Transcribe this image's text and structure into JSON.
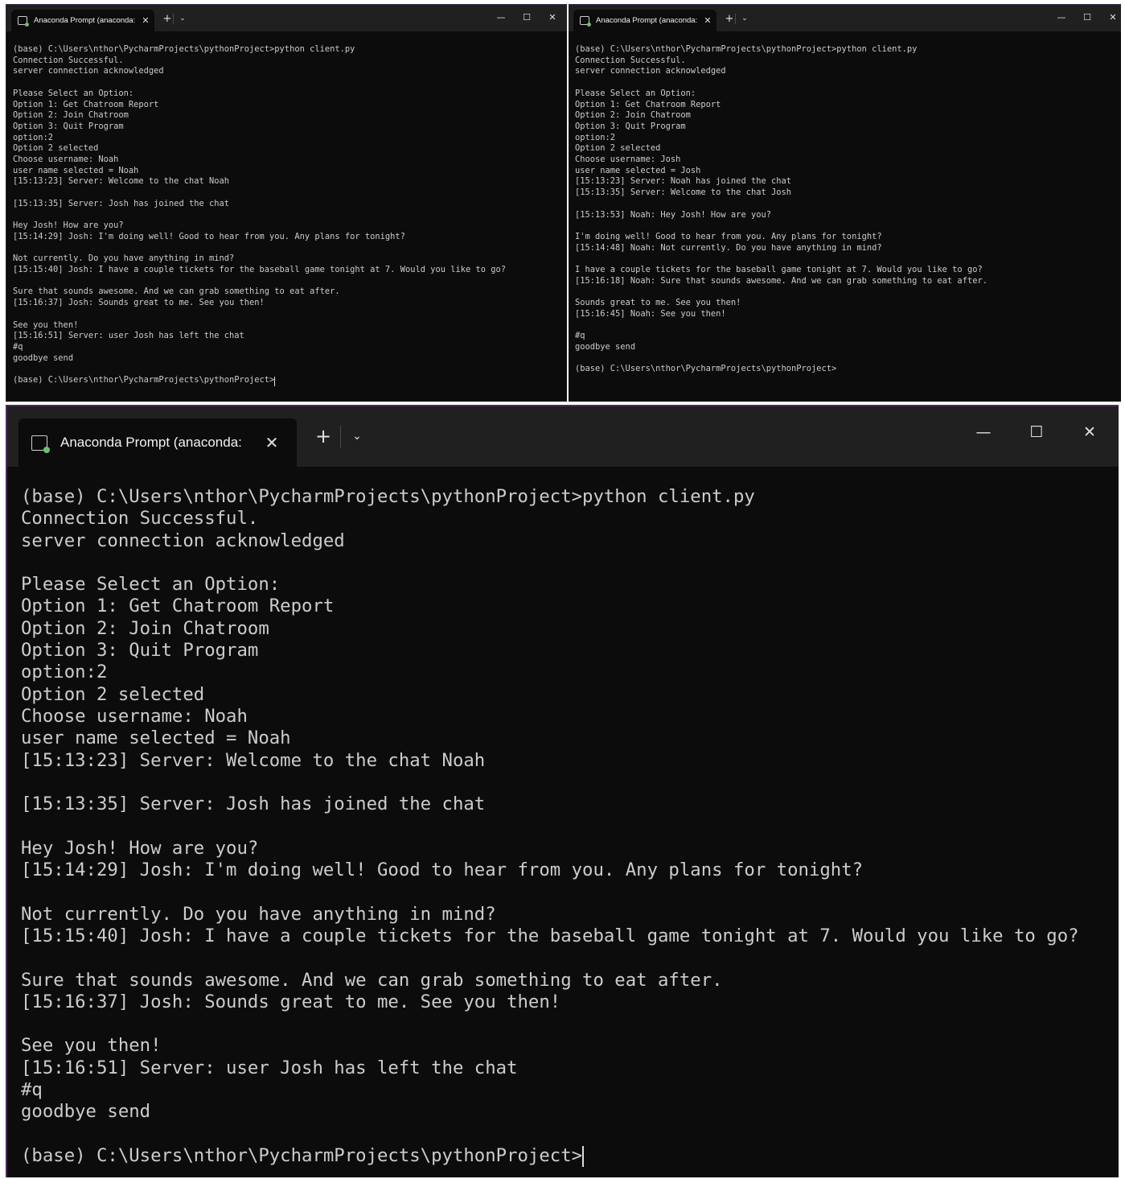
{
  "colors": {
    "terminal_bg": "#0c0c0c",
    "titlebar_bg": "#202020",
    "text": "#cccccc",
    "icon_accent": "#6cc06c"
  },
  "icons": {
    "tab_icon": "anaconda-prompt-icon",
    "tab_close": "close-icon",
    "new_tab": "plus-icon",
    "tab_menu": "chevron-down-icon",
    "minimize": "minimize-icon",
    "maximize": "maximize-icon",
    "close": "close-icon"
  },
  "controls": {
    "close_tab": "✕",
    "new_tab": "+",
    "dropdown": "⌄",
    "minimize": "—",
    "maximize": "☐",
    "close_window": "✕"
  },
  "windows": [
    {
      "id": "noah-small",
      "tab_title": "Anaconda Prompt (anaconda:",
      "lines": [
        "(base) C:\\Users\\nthor\\PycharmProjects\\pythonProject>python client.py",
        "Connection Successful.",
        "server connection acknowledged",
        "",
        "Please Select an Option:",
        "Option 1: Get Chatroom Report",
        "Option 2: Join Chatroom",
        "Option 3: Quit Program",
        "option:2",
        "Option 2 selected",
        "Choose username: Noah",
        "user name selected = Noah",
        "[15:13:23] Server: Welcome to the chat Noah",
        "",
        "[15:13:35] Server: Josh has joined the chat",
        "",
        "Hey Josh! How are you?",
        "[15:14:29] Josh: I'm doing well! Good to hear from you. Any plans for tonight?",
        "",
        "Not currently. Do you have anything in mind?",
        "[15:15:40] Josh: I have a couple tickets for the baseball game tonight at 7. Would you like to go?",
        "",
        "Sure that sounds awesome. And we can grab something to eat after.",
        "[15:16:37] Josh: Sounds great to me. See you then!",
        "",
        "See you then!",
        "[15:16:51] Server: user Josh has left the chat",
        "#q",
        "goodbye send",
        "",
        "(base) C:\\Users\\nthor\\PycharmProjects\\pythonProject>"
      ]
    },
    {
      "id": "josh-small",
      "tab_title": "Anaconda Prompt (anaconda:",
      "lines": [
        "(base) C:\\Users\\nthor\\PycharmProjects\\pythonProject>python client.py",
        "Connection Successful.",
        "server connection acknowledged",
        "",
        "Please Select an Option:",
        "Option 1: Get Chatroom Report",
        "Option 2: Join Chatroom",
        "Option 3: Quit Program",
        "option:2",
        "Option 2 selected",
        "Choose username: Josh",
        "user name selected = Josh",
        "[15:13:23] Server: Noah has joined the chat",
        "[15:13:35] Server: Welcome to the chat Josh",
        "",
        "[15:13:53] Noah: Hey Josh! How are you?",
        "",
        "I'm doing well! Good to hear from you. Any plans for tonight?",
        "[15:14:48] Noah: Not currently. Do you have anything in mind?",
        "",
        "I have a couple tickets for the baseball game tonight at 7. Would you like to go?",
        "[15:16:18] Noah: Sure that sounds awesome. And we can grab something to eat after.",
        "",
        "Sounds great to me. See you then!",
        "[15:16:45] Noah: See you then!",
        "",
        "#q",
        "goodbye send",
        "",
        "(base) C:\\Users\\nthor\\PycharmProjects\\pythonProject>"
      ]
    },
    {
      "id": "noah-large",
      "tab_title": "Anaconda Prompt (anaconda:",
      "lines": [
        "(base) C:\\Users\\nthor\\PycharmProjects\\pythonProject>python client.py",
        "Connection Successful.",
        "server connection acknowledged",
        "",
        "Please Select an Option:",
        "Option 1: Get Chatroom Report",
        "Option 2: Join Chatroom",
        "Option 3: Quit Program",
        "option:2",
        "Option 2 selected",
        "Choose username: Noah",
        "user name selected = Noah",
        "[15:13:23] Server: Welcome to the chat Noah",
        "",
        "[15:13:35] Server: Josh has joined the chat",
        "",
        "Hey Josh! How are you?",
        "[15:14:29] Josh: I'm doing well! Good to hear from you. Any plans for tonight?",
        "",
        "Not currently. Do you have anything in mind?",
        "[15:15:40] Josh: I have a couple tickets for the baseball game tonight at 7. Would you like to go?",
        "",
        "Sure that sounds awesome. And we can grab something to eat after.",
        "[15:16:37] Josh: Sounds great to me. See you then!",
        "",
        "See you then!",
        "[15:16:51] Server: user Josh has left the chat",
        "#q",
        "goodbye send",
        "",
        "(base) C:\\Users\\nthor\\PycharmProjects\\pythonProject>"
      ]
    }
  ]
}
